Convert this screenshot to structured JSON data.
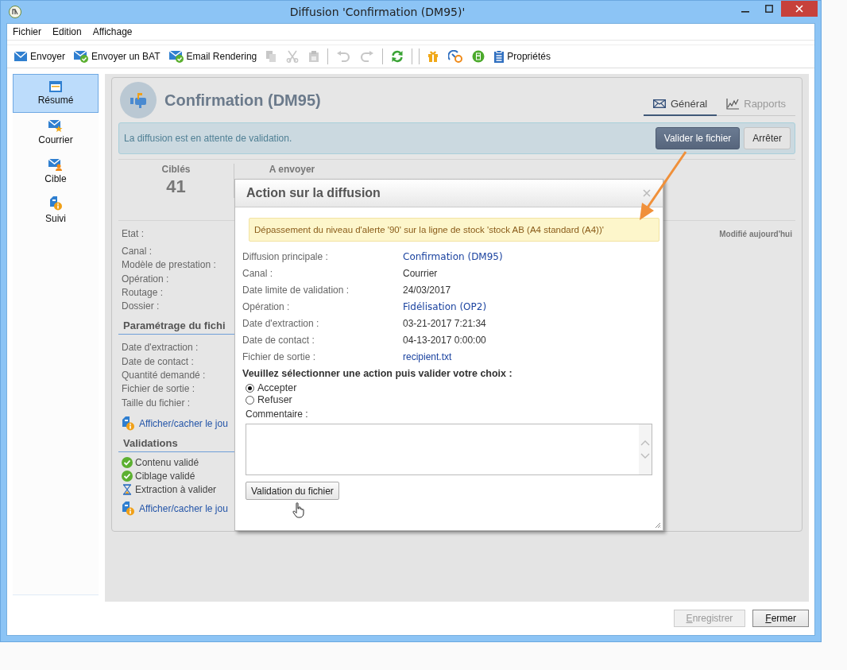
{
  "window": {
    "title": "Diffusion 'Confirmation (DM95)'"
  },
  "menu": [
    "Fichier",
    "Edition",
    "Affichage"
  ],
  "toolbar": [
    {
      "kind": "send",
      "label": "Envoyer",
      "disabled": false
    },
    {
      "kind": "proof",
      "label": "Envoyer un BAT",
      "disabled": false
    },
    {
      "kind": "proof",
      "label": "Email Rendering",
      "disabled": false
    },
    {
      "kind": "copy",
      "disabled": true
    },
    {
      "kind": "cut",
      "disabled": true
    },
    {
      "kind": "paste",
      "disabled": true
    },
    {
      "kind": "separator"
    },
    {
      "kind": "undo",
      "disabled": true
    },
    {
      "kind": "redo",
      "disabled": true
    },
    {
      "kind": "separator"
    },
    {
      "kind": "refresh",
      "disabled": false
    },
    {
      "kind": "separator"
    },
    {
      "kind": "separator"
    },
    {
      "kind": "gift",
      "disabled": false
    },
    {
      "kind": "gauge",
      "disabled": false
    },
    {
      "kind": "calculator",
      "disabled": false
    },
    {
      "kind": "clipboard",
      "label": "Propriétés",
      "disabled": false
    }
  ],
  "sidebar": {
    "items": [
      {
        "kind": "summary",
        "label": "Résumé",
        "selected": true
      },
      {
        "kind": "mail",
        "label": "Courrier",
        "selected": false
      },
      {
        "kind": "target",
        "label": "Cible",
        "selected": false
      },
      {
        "kind": "tracking",
        "label": "Suivi",
        "selected": false
      }
    ]
  },
  "header": {
    "title": "Confirmation (DM95)",
    "tabs": [
      {
        "kind": "general",
        "label": "Général",
        "selected": true
      },
      {
        "kind": "reports",
        "label": "Rapports",
        "selected": false
      }
    ]
  },
  "notice": {
    "text": "La diffusion est en attente de validation.",
    "primary_button": "Valider le fichier",
    "secondary_button": "Arrêter"
  },
  "stats": [
    {
      "label": "Ciblés",
      "value": "41"
    },
    {
      "label": "A envoyer"
    }
  ],
  "summary": {
    "state_label": "Etat :",
    "modified": "Modifié aujourd'hui",
    "fields": [
      "Canal :",
      "Modèle de prestation :",
      "Opération :",
      "Routage :",
      "Dossier :"
    ],
    "file_section": {
      "title": "Paramétrage du fichi",
      "fields": [
        "Date d'extraction :",
        "Date de contact :",
        "Quantité demandé :",
        "Fichier de sortie :",
        "Taille du fichier :"
      ],
      "link": "Afficher/cacher le jou"
    },
    "validations": {
      "title": "Validations",
      "items": [
        {
          "label": "Contenu validé",
          "kind": "done"
        },
        {
          "label": "Ciblage validé",
          "kind": "done"
        },
        {
          "label": "Extraction à valider",
          "kind": "pending"
        }
      ],
      "link": "Afficher/cacher le jou"
    }
  },
  "dialog": {
    "title": "Action sur la diffusion",
    "warning": "Dépassement du niveau d'alerte '90' sur la ligne de stock 'stock AB (A4 standard (A4))'",
    "fields": [
      {
        "label": "Diffusion principale :",
        "value": "Confirmation (DM95)",
        "kind": "link"
      },
      {
        "label": "Canal :",
        "value": "Courrier",
        "kind": "text"
      },
      {
        "label": "Date limite de validation :",
        "value": "24/03/2017",
        "kind": "text"
      },
      {
        "label": "Opération :",
        "value": "Fidélisation (OP2)",
        "kind": "link"
      },
      {
        "label": "Date d'extraction :",
        "value": "03-21-2017 7:21:34",
        "kind": "text"
      },
      {
        "label": "Date de contact :",
        "value": "04-13-2017 0:00:00",
        "kind": "text"
      },
      {
        "label": "Fichier de sortie :",
        "value": "recipient.txt",
        "kind": "file"
      }
    ],
    "prompt": "Veuillez sélectionner une action puis valider votre choix :",
    "options": [
      {
        "label": "Accepter",
        "selected": true
      },
      {
        "label": "Refuser",
        "selected": false
      }
    ],
    "comment_label": "Commentaire :",
    "submit": "Validation du fichier"
  },
  "footer": {
    "buttons": [
      {
        "label": "Enregistrer",
        "disabled": true
      },
      {
        "label": "Fermer",
        "disabled": false
      }
    ]
  }
}
